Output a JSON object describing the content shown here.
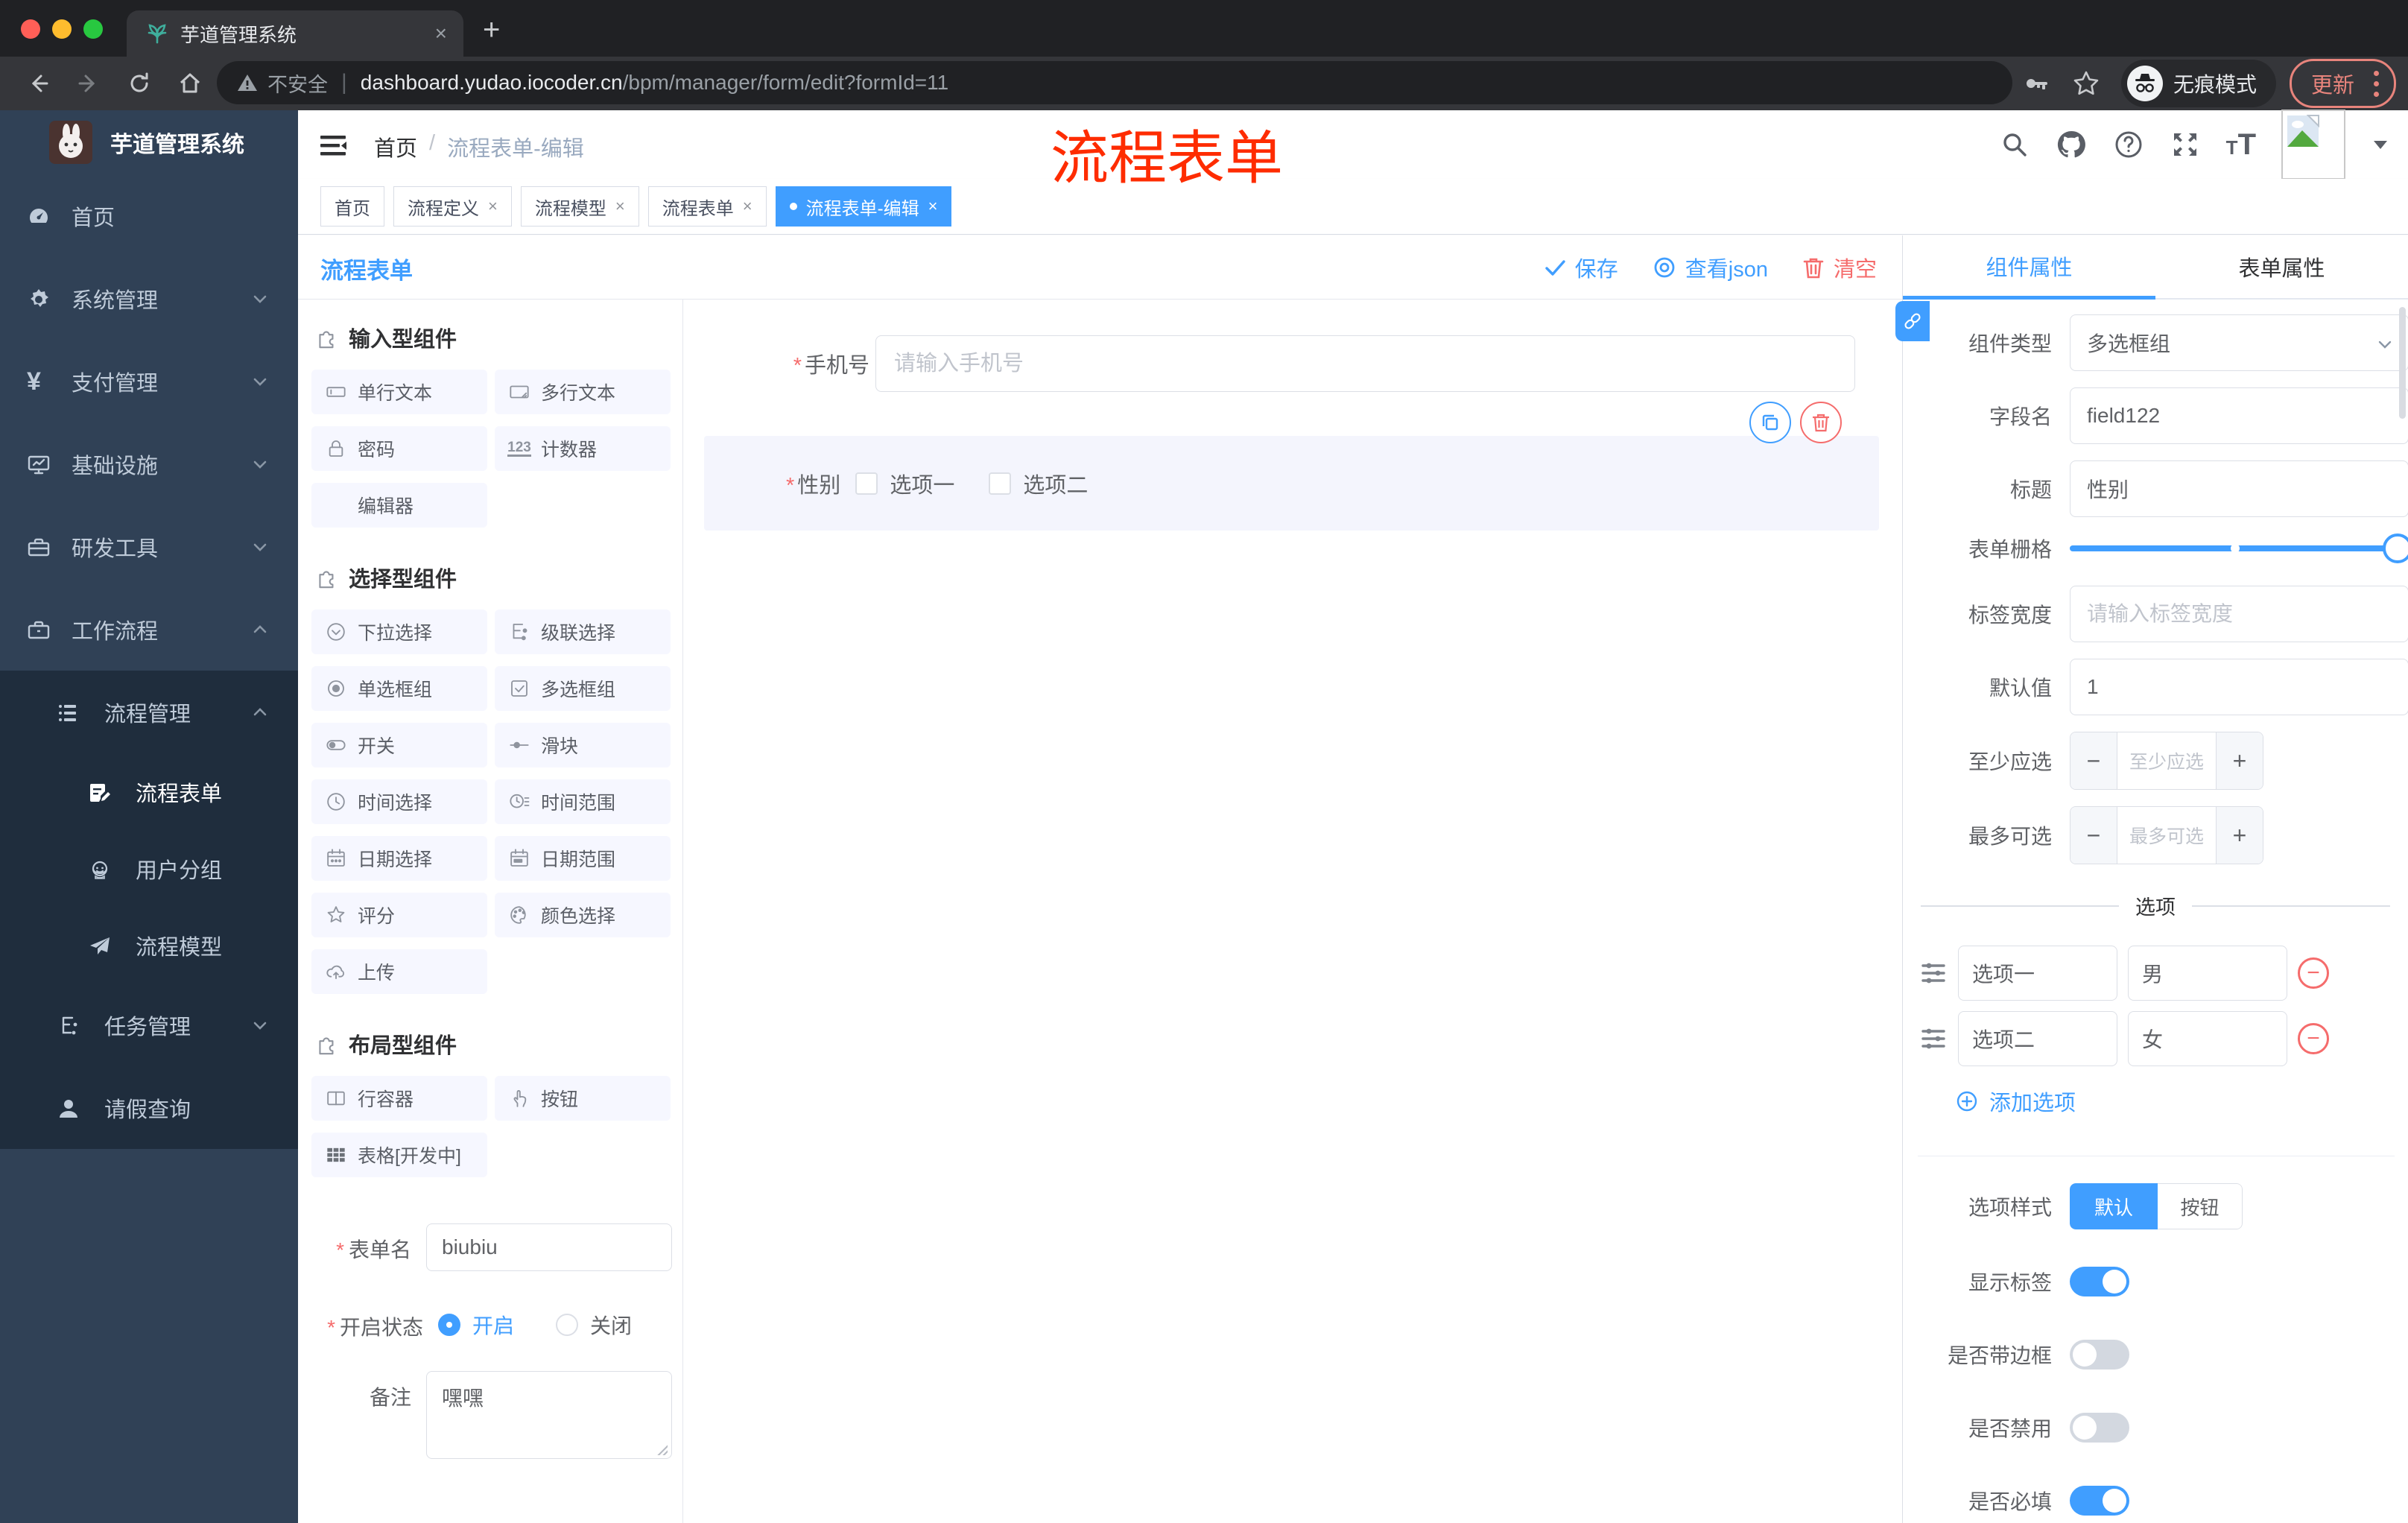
{
  "browser": {
    "tab_title": "芋道管理系统",
    "tab_close": "×",
    "new_tab": "+",
    "security": "不安全",
    "url_domain": "dashboard.yudao.iocoder.cn",
    "url_path": "/bpm/manager/form/edit?formId=11",
    "incognito": "无痕模式",
    "update": "更新"
  },
  "sidebar": {
    "brand": "芋道管理系统",
    "items": [
      {
        "label": "首页"
      },
      {
        "label": "系统管理"
      },
      {
        "label": "支付管理"
      },
      {
        "label": "基础设施"
      },
      {
        "label": "研发工具"
      },
      {
        "label": "工作流程"
      }
    ],
    "sub": {
      "manage": "流程管理",
      "children": [
        {
          "label": "流程表单"
        },
        {
          "label": "用户分组"
        },
        {
          "label": "流程模型"
        }
      ],
      "task": "任务管理",
      "leave": "请假查询"
    }
  },
  "header": {
    "breadcrumb_home": "首页",
    "breadcrumb_sep": "/",
    "breadcrumb_current": "流程表单-编辑",
    "watermark": "流程表单"
  },
  "tags": [
    {
      "label": "首页"
    },
    {
      "label": "流程定义"
    },
    {
      "label": "流程模型"
    },
    {
      "label": "流程表单"
    },
    {
      "label": "流程表单-编辑"
    }
  ],
  "toolbar": {
    "title": "流程表单",
    "save": "保存",
    "view_json": "查看json",
    "clear": "清空"
  },
  "palette": {
    "sections": [
      {
        "title": "输入型组件",
        "items": [
          {
            "label": "单行文本"
          },
          {
            "label": "多行文本"
          },
          {
            "label": "密码"
          },
          {
            "label": "计数器"
          },
          {
            "label": "编辑器"
          }
        ]
      },
      {
        "title": "选择型组件",
        "items": [
          {
            "label": "下拉选择"
          },
          {
            "label": "级联选择"
          },
          {
            "label": "单选框组"
          },
          {
            "label": "多选框组"
          },
          {
            "label": "开关"
          },
          {
            "label": "滑块"
          },
          {
            "label": "时间选择"
          },
          {
            "label": "时间范围"
          },
          {
            "label": "日期选择"
          },
          {
            "label": "日期范围"
          },
          {
            "label": "评分"
          },
          {
            "label": "颜色选择"
          },
          {
            "label": "上传"
          }
        ]
      },
      {
        "title": "布局型组件",
        "items": [
          {
            "label": "行容器"
          },
          {
            "label": "按钮"
          },
          {
            "label": "表格[开发中]"
          }
        ]
      }
    ]
  },
  "left_form": {
    "name_label": "表单名",
    "name_value": "biubiu",
    "status_label": "开启状态",
    "on": "开启",
    "off": "关闭",
    "remark_label": "备注",
    "remark_value": "嘿嘿"
  },
  "canvas": {
    "phone_label": "手机号",
    "phone_placeholder": "请输入手机号",
    "gender_label": "性别",
    "opt1": "选项一",
    "opt2": "选项二"
  },
  "panel": {
    "tab_component": "组件属性",
    "tab_form": "表单属性",
    "type_label": "组件类型",
    "type_value": "多选框组",
    "field_label": "字段名",
    "field_value": "field122",
    "title_label": "标题",
    "title_value": "性别",
    "grid_label": "表单栅格",
    "width_label": "标签宽度",
    "width_placeholder": "请输入标签宽度",
    "default_label": "默认值",
    "default_value": "1",
    "min_label": "至少应选",
    "min_placeholder": "至少应选",
    "max_label": "最多可选",
    "max_placeholder": "最多可选",
    "minus": "−",
    "plus": "+",
    "options_title": "选项",
    "options": [
      {
        "label": "选项一",
        "value": "男"
      },
      {
        "label": "选项二",
        "value": "女"
      }
    ],
    "add_option": "添加选项",
    "style_label": "选项样式",
    "style_default": "默认",
    "style_button": "按钮",
    "show_label": "显示标签",
    "border_label": "是否带边框",
    "disabled_label": "是否禁用",
    "required_label": "是否必填"
  },
  "colors": {
    "accent": "#409eff",
    "danger": "#f56c6c",
    "watermark": "#fe2c00",
    "sidebar": "#304156"
  }
}
